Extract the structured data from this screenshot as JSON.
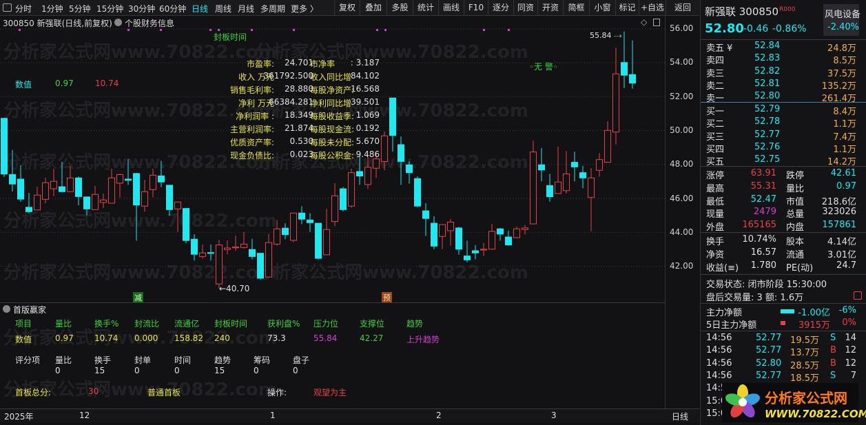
{
  "toolbar": {
    "periods": [
      "分时",
      "1分钟",
      "5分钟",
      "15分钟",
      "30分钟",
      "60分钟",
      "日线",
      "周线",
      "月线",
      "多周期",
      "更多 〉"
    ],
    "active_period": "日线",
    "buttons": [
      "复权",
      "叠加",
      "多股",
      "统计",
      "画线",
      "F10",
      "逐分",
      "同资",
      "开资",
      "简框",
      "小窗",
      "标记",
      "+自选",
      "返回"
    ]
  },
  "title": {
    "stock": "300850 新强联(日线,前复权)",
    "indicator": "个股财务信息"
  },
  "overlay": {
    "seal_time_label": "封板时间",
    "value_label": "数值",
    "value1": "0.97",
    "value2": "10.74",
    "warning": "无 警",
    "high_marker": "55.84",
    "low_marker": "←40.70",
    "mark_reduce": "减",
    "mark_pre": "预",
    "financials": [
      [
        "市盈率:",
        "24.701",
        "市净率",
        ": 3.187"
      ],
      [
        "收入 万元",
        "361792.500",
        "收入同比增",
        "84.102"
      ],
      [
        "销售毛利率:",
        "28.880",
        "每股净资产:",
        "16.568"
      ],
      [
        "净利 万元",
        "66384.281",
        "净利同比增",
        "39.501"
      ],
      [
        "净利润率 :",
        "18.349",
        "每股收益季:",
        "1.069"
      ],
      [
        "主营利润率:",
        "21.874",
        "每股现金流:",
        "0.192"
      ],
      [
        "优质资产率:",
        "0.530",
        "每股未分配:",
        "5.670"
      ],
      [
        "现金负债比:",
        "0.023",
        "每股公积金:",
        "9.486"
      ]
    ]
  },
  "axis_labels": [
    "56.00",
    "54.00",
    "52.00",
    "50.00",
    "48.00",
    "46.00",
    "44.00",
    "42.00"
  ],
  "date_labels": [
    "2025年",
    "12",
    "1",
    "2",
    "3"
  ],
  "period_label": "日线",
  "watermark": "分析家公式网www.70822.com",
  "lower": {
    "title": "首版赢家",
    "headers": [
      "项目",
      "量比",
      "换手%",
      "封流比",
      "流通亿",
      "封板时间",
      "获利盘%",
      "压力位",
      "支撑位",
      "趋势"
    ],
    "values": [
      "数值",
      "0.97",
      "10.74",
      "0.000",
      "158.82",
      "240",
      "73.3",
      "55.84",
      "42.27",
      "上升趋势"
    ],
    "score_headers": [
      "评分项",
      "量比",
      "换手",
      "封单",
      "时间",
      "趋势",
      "筹码",
      "盘子"
    ],
    "scores": [
      "0",
      "15",
      "0",
      "0",
      "15",
      "0",
      "0"
    ],
    "total_label": "首板总分:",
    "total": "30",
    "board_type": "普通首板",
    "op_label": "操作:",
    "op_value": "观望为主"
  },
  "quote": {
    "name": "新强联 300850",
    "tag": "R000",
    "price": "52.80",
    "change": "-0.46",
    "pct": "-0.86%",
    "sector": "风电设备",
    "sector_pct": "-2.40%",
    "asks": [
      [
        "卖五 ¥",
        "52.84",
        "24.8万"
      ],
      [
        "卖四",
        "52.83",
        "8.5万"
      ],
      [
        "卖三",
        "52.82",
        "37.5万"
      ],
      [
        "卖二",
        "52.81",
        "135.2万"
      ],
      [
        "卖一",
        "52.80",
        "261.4万"
      ]
    ],
    "bids": [
      [
        "买一",
        "52.79",
        "8.4万"
      ],
      [
        "买二",
        "52.78",
        "1.1万"
      ],
      [
        "买三",
        "52.77",
        "7.4万"
      ],
      [
        "买四",
        "52.76",
        "1.1万"
      ],
      [
        "买五",
        "52.75",
        "14.2万"
      ]
    ],
    "stats": [
      [
        "涨停",
        "63.91",
        "跌停",
        "42.61"
      ],
      [
        "最高",
        "55.31",
        "量比",
        "0.97"
      ],
      [
        "最低",
        "52.47",
        "市值",
        "218.6亿"
      ],
      [
        "现量",
        "2479",
        "总量",
        "323026"
      ],
      [
        "外盘",
        "165165",
        "内盘",
        "157861"
      ]
    ],
    "stats2": [
      [
        "换手",
        "10.74%",
        "股本",
        "4.14亿"
      ],
      [
        "净资",
        "16.57",
        "流通",
        "3.01亿"
      ],
      [
        "收益(≡)",
        "1.780",
        "PE(动)",
        "24.7"
      ]
    ],
    "status": "交易状态: 闭市阶段 15:30:00",
    "after": "盘后交易量: 3  额: 1.6万",
    "flow": [
      [
        "主力净额",
        "-1.00亿",
        "-6%"
      ],
      [
        "5日主力净额",
        "3915万",
        "0%"
      ]
    ],
    "trades": [
      [
        "14:56",
        "52.77",
        "19.5万",
        "S",
        "14"
      ],
      [
        "14:56",
        "52.77",
        "13.7万",
        "B",
        "12"
      ],
      [
        "14:56",
        "52.80",
        "28.5万",
        "B",
        "12"
      ],
      [
        "14:56",
        "52.77",
        "18.5万",
        "S",
        "7"
      ],
      [
        "14:5",
        "",
        "",
        "",
        ""
      ],
      [
        "15:0",
        "",
        "",
        "",
        ""
      ],
      [
        "15:0",
        "",
        "",
        "",
        ""
      ]
    ]
  },
  "logo": {
    "text": "分析家公式网",
    "url": "WWW.70822.COM"
  },
  "colors": {
    "up": "#e8404a",
    "down": "#1fe8f0",
    "bg": "#121214"
  },
  "chart_data": {
    "type": "candlestick",
    "title": "300850 新强联(日线,前复权)",
    "ylim": [
      40.5,
      56.5
    ],
    "yticks": [
      42,
      44,
      46,
      48,
      50,
      52,
      54,
      56
    ],
    "ohlc": [
      [
        50.72,
        50.75,
        47.26,
        47.44
      ],
      [
        47.41,
        48.85,
        46.41,
        46.85
      ],
      [
        47.14,
        47.95,
        45.8,
        45.96
      ],
      [
        45.48,
        46.33,
        45.11,
        45.22
      ],
      [
        45.32,
        46.69,
        45.3,
        46.2
      ],
      [
        45.95,
        47.22,
        45.72,
        46.93
      ],
      [
        46.57,
        47.75,
        46.13,
        47.01
      ],
      [
        46.69,
        48.16,
        46.37,
        46.4
      ],
      [
        46.4,
        47.91,
        46.4,
        47.21
      ],
      [
        47.21,
        47.3,
        45.6,
        46.11
      ],
      [
        46.09,
        46.1,
        45.0,
        45.38
      ],
      [
        45.34,
        46.74,
        45.34,
        46.24
      ],
      [
        45.76,
        46.29,
        45.44,
        45.91
      ],
      [
        45.72,
        47.75,
        45.72,
        47.21
      ],
      [
        46.9,
        47.47,
        46.05,
        47.41
      ],
      [
        47.14,
        48.33,
        46.8,
        47.07
      ],
      [
        47.47,
        47.5,
        43.52,
        45.61
      ],
      [
        45.55,
        47.1,
        45.22,
        46.4
      ],
      [
        46.52,
        47.75,
        46.06,
        47.37
      ],
      [
        47.33,
        48.22,
        46.67,
        46.97
      ],
      [
        46.78,
        46.8,
        44.98,
        45.34
      ],
      [
        45.38,
        45.8,
        44.03,
        45.79
      ],
      [
        45.41,
        45.42,
        43.36,
        43.52
      ],
      [
        43.6,
        43.9,
        42.34,
        42.71
      ],
      [
        42.58,
        43.29,
        42.45,
        42.79
      ],
      [
        42.81,
        43.29,
        42.34,
        42.78
      ],
      [
        40.96,
        43.56,
        40.7,
        43.26
      ],
      [
        42.99,
        43.53,
        42.71,
        43.08
      ],
      [
        43.12,
        43.8,
        42.91,
        43.14
      ],
      [
        43.11,
        44.03,
        43.05,
        43.31
      ],
      [
        42.99,
        43.62,
        42.41,
        42.58
      ],
      [
        42.77,
        42.78,
        41.22,
        41.3
      ],
      [
        41.37,
        43.92,
        41.35,
        43.4
      ],
      [
        43.31,
        44.73,
        43.22,
        44.21
      ],
      [
        44.25,
        44.54,
        43.6,
        43.87
      ],
      [
        43.53,
        45.15,
        43.42,
        45.14
      ],
      [
        45.14,
        45.55,
        44.48,
        44.78
      ],
      [
        44.73,
        45.14,
        44.03,
        44.57
      ],
      [
        44.54,
        44.55,
        42.41,
        42.47
      ],
      [
        42.68,
        45.38,
        42.66,
        44.17
      ],
      [
        44.64,
        46.9,
        44.37,
        46.16
      ],
      [
        46.57,
        46.67,
        45.25,
        45.34
      ],
      [
        45.55,
        47.75,
        45.45,
        47.52
      ],
      [
        47.59,
        48.49,
        46.8,
        47.32
      ],
      [
        46.82,
        48.49,
        46.56,
        47.84
      ],
      [
        47.78,
        48.6,
        47.21,
        48.33
      ],
      [
        48.18,
        49.94,
        47.66,
        49.69
      ],
      [
        51.92,
        51.92,
        48.76,
        49.71
      ],
      [
        49.17,
        49.65,
        46.8,
        48.18
      ],
      [
        47.98,
        48.18,
        46.87,
        47.52
      ],
      [
        47.17,
        47.3,
        45.49,
        45.55
      ],
      [
        45.27,
        45.72,
        43.79,
        44.82
      ],
      [
        44.54,
        44.95,
        43.01,
        43.19
      ],
      [
        43.76,
        44.46,
        43.01,
        44.46
      ],
      [
        44.1,
        44.78,
        43.22,
        44.61
      ],
      [
        44.26,
        44.33,
        42.68,
        43.01
      ],
      [
        42.61,
        43.52,
        42.24,
        42.38
      ],
      [
        42.92,
        43.25,
        42.41,
        42.79
      ],
      [
        42.99,
        43.38,
        42.61,
        43.01
      ],
      [
        43.01,
        44.5,
        43.0,
        44.06
      ],
      [
        44.21,
        44.26,
        43.52,
        43.9
      ],
      [
        43.73,
        44.1,
        43.22,
        43.26
      ],
      [
        43.69,
        44.34,
        43.65,
        44.21
      ],
      [
        44.17,
        44.43,
        43.87,
        44.26
      ],
      [
        44.5,
        49.41,
        44.5,
        48.74
      ],
      [
        47.98,
        48.97,
        47.01,
        47.68
      ],
      [
        46.76,
        47.45,
        45.81,
        46.1
      ],
      [
        46.29,
        49.06,
        46.28,
        46.97
      ],
      [
        46.46,
        48.79,
        46.3,
        47.45
      ],
      [
        48.13,
        48.76,
        47.01,
        47.86
      ],
      [
        47.52,
        47.92,
        46.6,
        47.21
      ],
      [
        46.06,
        47.79,
        44.07,
        47.21
      ],
      [
        47.66,
        48.67,
        47.28,
        48.29
      ],
      [
        48.13,
        50.55,
        48.12,
        50.01
      ],
      [
        49.91,
        54.89,
        49.17,
        53.34
      ],
      [
        54.01,
        55.84,
        52.51,
        53.26
      ],
      [
        53.3,
        55.31,
        52.47,
        52.8
      ]
    ]
  }
}
